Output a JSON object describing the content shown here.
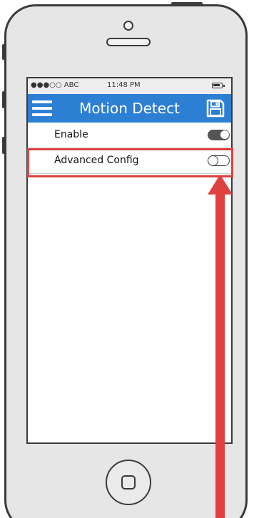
{
  "status_bar": {
    "carrier": "●●●○○ ABC",
    "time": "11:48 PM",
    "battery_icon": "battery-icon"
  },
  "nav_bar": {
    "title": "Motion Detect",
    "menu_icon": "hamburger-menu-icon",
    "save_icon": "floppy-disk-save-icon",
    "background_color": "#2d7fd3"
  },
  "settings": [
    {
      "label": "Enable",
      "toggle_state": "on"
    },
    {
      "label": "Advanced Config",
      "toggle_state": "off",
      "highlighted": true
    }
  ],
  "annotation": {
    "highlight_color": "#e04040",
    "arrow_icon": "red-arrow-pointing-up-icon",
    "arrow_target": "Advanced Config"
  },
  "device": {
    "home_button_icon": "home-button-icon"
  }
}
